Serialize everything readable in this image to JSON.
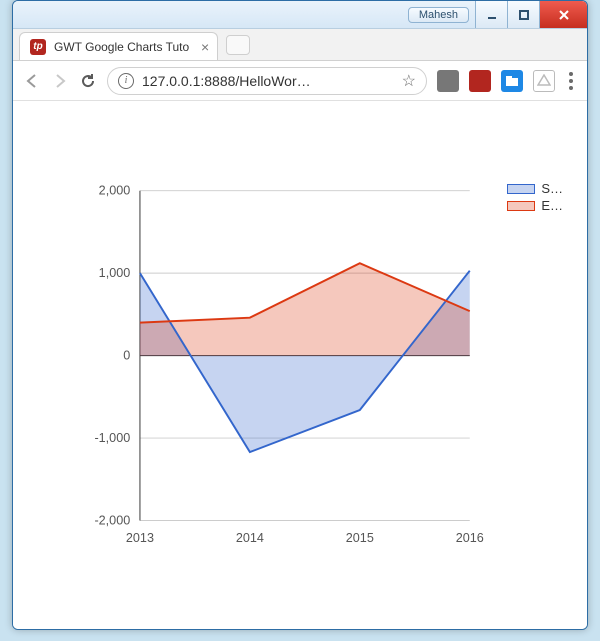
{
  "window": {
    "user_label": "Mahesh"
  },
  "tab": {
    "title": "GWT Google Charts Tuto"
  },
  "addressbar": {
    "url": "127.0.0.1:8888/HelloWor…"
  },
  "legend": {
    "items": [
      {
        "label": "S…"
      },
      {
        "label": "E…"
      }
    ]
  },
  "axes": {
    "y_ticks": [
      "2,000",
      "1,000",
      "0",
      "-1,000",
      "-2,000"
    ],
    "x_ticks": [
      "2013",
      "2014",
      "2015",
      "2016"
    ]
  },
  "chart_data": {
    "type": "area",
    "categories": [
      "2013",
      "2014",
      "2015",
      "2016"
    ],
    "series": [
      {
        "name": "S…",
        "values": [
          1000,
          -1170,
          -660,
          1030
        ],
        "color": "#3366cc"
      },
      {
        "name": "E…",
        "values": [
          400,
          460,
          1120,
          540
        ],
        "color": "#dc3912"
      }
    ],
    "title": "",
    "xlabel": "",
    "ylabel": "",
    "ylim": [
      -2000,
      2000
    ]
  }
}
